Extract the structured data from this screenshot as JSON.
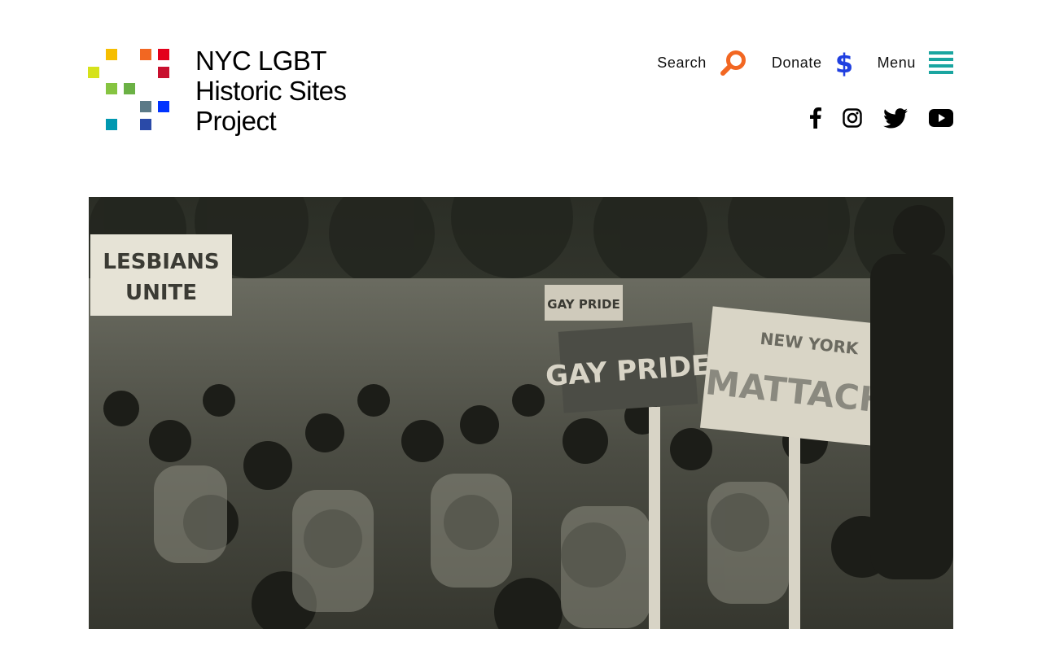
{
  "site": {
    "logo_lines": [
      "NYC LGBT",
      "Historic Sites",
      "Project"
    ],
    "logo_colors": [
      "#f6be00",
      "#f26722",
      "#e3001b",
      "#c8102e",
      "#d6e21b",
      "#86c441",
      "#6bb145",
      "#5b7a87",
      "#0033ff",
      "#0098b0",
      "#2a4aa8"
    ]
  },
  "nav": {
    "search_label": "Search",
    "donate_label": "Donate",
    "menu_label": "Menu",
    "search_icon_color": "#f26722",
    "donate_icon_color": "#1f3fe0",
    "menu_icon_color": "#1aa5a0"
  },
  "social": {
    "icons": [
      "facebook-icon",
      "instagram-icon",
      "twitter-icon",
      "youtube-icon"
    ]
  },
  "hero": {
    "signs": [
      "LESBIANS UNITE",
      "GAY PRIDE",
      "GAY PRIDE",
      "NEW YORK MATTACHINE"
    ]
  }
}
